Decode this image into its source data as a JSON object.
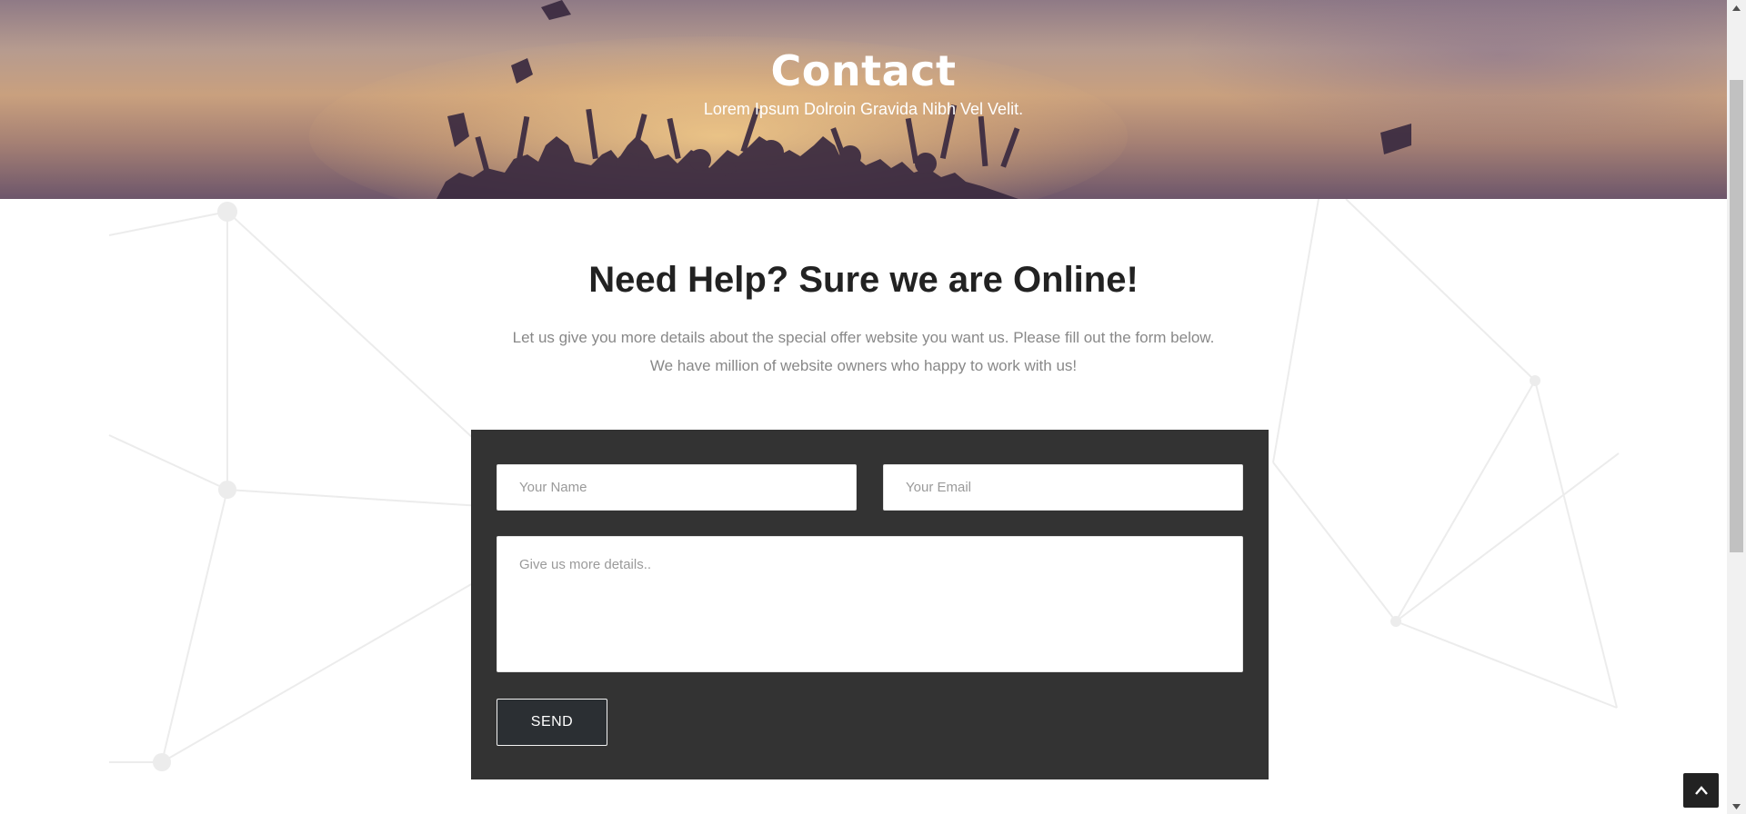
{
  "hero": {
    "title": "Contact",
    "subtitle": "Lorem Ipsum Dolroin Gravida Nibh Vel Velit."
  },
  "section": {
    "heading": "Need Help? Sure we are Online!",
    "lead_line1": "Let us give you more details about the special offer website you want us. Please fill out the form below.",
    "lead_line2": "We have million of website owners who happy to work with us!"
  },
  "form": {
    "name_placeholder": "Your Name",
    "name_value": "",
    "email_placeholder": "Your Email",
    "email_value": "",
    "details_placeholder": "Give us more details..",
    "details_value": "",
    "send_label": "SEND"
  },
  "icons": {
    "back_to_top": "chevron-up-icon",
    "scroll_up": "triangle-up-icon",
    "scroll_down": "triangle-down-icon"
  },
  "colors": {
    "form_panel": "#333333",
    "heading": "#222222",
    "lead": "#888888",
    "back_to_top": "#222222"
  }
}
